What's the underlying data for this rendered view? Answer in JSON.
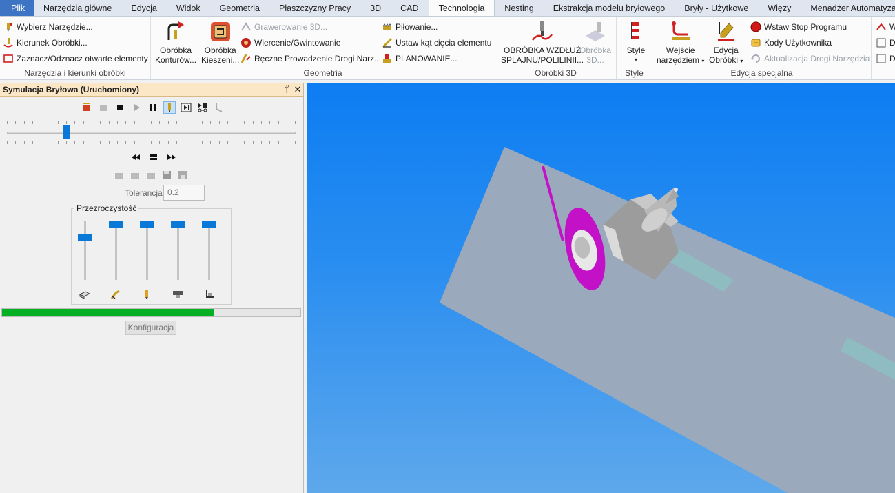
{
  "menu": {
    "tabs": [
      "Plik",
      "Narzędzia główne",
      "Edycja",
      "Widok",
      "Geometria",
      "Płaszczyzny Pracy",
      "3D",
      "CAD",
      "Technologia",
      "Nesting",
      "Ekstrakcja modelu bryłowego",
      "Bryły - Użytkowe",
      "Więzy",
      "Menadżer Automatyzacji Nes"
    ],
    "active": "Technologia"
  },
  "ribbon": {
    "tools": {
      "select_tool": "Wybierz Narzędzie...",
      "direction": "Kierunek Obróbki...",
      "toggle_open": "Zaznacz/Odznacz otwarte elementy",
      "label": "Narzędzia i kierunki obróbki"
    },
    "geometry": {
      "contour_l1": "Obróbka",
      "contour_l2": "Konturów...",
      "pocket_l1": "Obróbka",
      "pocket_l2": "Kieszeni...",
      "engrave": "Grawerowanie 3D...",
      "drill": "Wiercenie/Gwintowanie",
      "manual": "Ręczne Prowadzenie Drogi Narz...",
      "saw": "Piłowanie...",
      "cut_angle": "Ustaw kąt cięcia elementu",
      "planing": "PLANOWANIE...",
      "label": "Geometria"
    },
    "ops3d": {
      "spline_l1": "OBRÓBKA WZDŁUŻ",
      "spline_l2": "SPLAJNU/POLILINII...",
      "o3d_l1": "Obróbka",
      "o3d_l2": "3D...",
      "label": "Obróbki 3D"
    },
    "style": {
      "btn": "Style",
      "label": "Style"
    },
    "special": {
      "entry_l1": "Wejście",
      "entry_l2": "narzędziem",
      "edit_l1": "Edycja",
      "edit_l2": "Obróbki",
      "stop": "Wstaw Stop Programu",
      "codes": "Kody Użytkownika",
      "update": "Aktualizacja Drogi Narzędzia",
      "label": "Edycja specjalna"
    },
    "extra": {
      "a": "W",
      "b": "D",
      "c": "D"
    }
  },
  "panel": {
    "title": "Symulacja Bryłowa (Uruchomiony)",
    "pin": "ᛘ",
    "close": "✕",
    "timeline_position": 0.2,
    "tolerance_label": "Tolerancja",
    "tolerance_value": "0.2",
    "transparency_label": "Przezroczystość",
    "transparency_levels": [
      0.25,
      0.0,
      0.0,
      0.0,
      0.0
    ],
    "progress": 0.71,
    "config_label": "Konfiguracja"
  },
  "colors": {
    "accent": "#0a78d7",
    "progress": "#06b025",
    "file_tab": "#3d74c4",
    "toolpath": "#c311c8"
  }
}
